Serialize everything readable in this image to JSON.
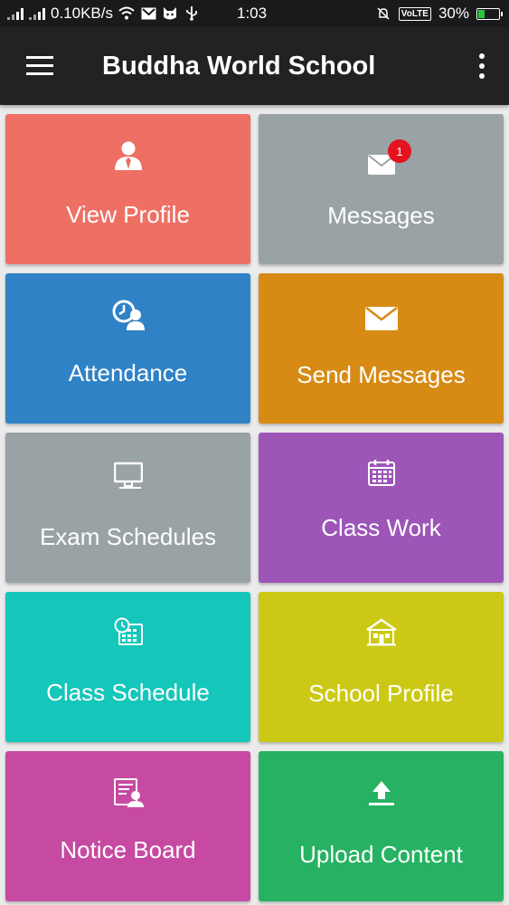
{
  "status_bar": {
    "speed": "0.10KB/s",
    "time": "1:03",
    "volte": "VoLTE",
    "battery": "30%",
    "battery_level": 0.3
  },
  "app_bar": {
    "title": "Buddha World School",
    "menu_icon": "hamburger-menu-icon",
    "more_icon": "more-vert-icon"
  },
  "tiles": [
    {
      "label": "View Profile",
      "color": "#ee7064",
      "icon": "user-profile-icon"
    },
    {
      "label": "Messages",
      "color": "#99a3a5",
      "icon": "envelope-icon",
      "badge": "1"
    },
    {
      "label": "Attendance",
      "color": "#2f82c6",
      "icon": "clock-user-icon"
    },
    {
      "label": "Send Messages",
      "color": "#d78b14",
      "icon": "envelope-icon"
    },
    {
      "label": "Exam Schedules",
      "color": "#99a3a5",
      "icon": "monitor-icon"
    },
    {
      "label": "Class Work",
      "color": "#9d55b8",
      "icon": "calendar-icon"
    },
    {
      "label": "Class Schedule",
      "color": "#15c6ba",
      "icon": "clock-calendar-icon"
    },
    {
      "label": "School Profile",
      "color": "#cbc915",
      "icon": "school-building-icon"
    },
    {
      "label": "Notice Board",
      "color": "#c64aa1",
      "icon": "notice-board-icon"
    },
    {
      "label": "Upload Content",
      "color": "#26b262",
      "icon": "upload-icon"
    }
  ]
}
